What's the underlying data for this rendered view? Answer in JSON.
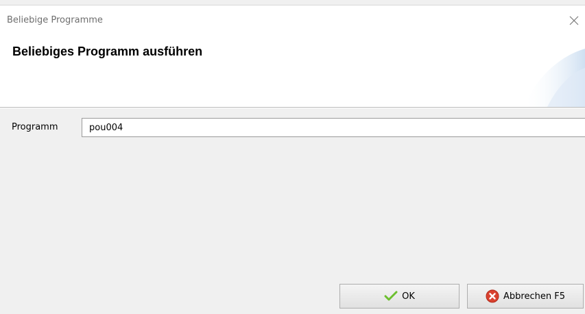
{
  "window": {
    "title": "Beliebige Programme",
    "close_icon": "close-icon"
  },
  "header": {
    "title": "Beliebiges Programm ausführen"
  },
  "form": {
    "program_label": "Programm",
    "program_value": "pou004"
  },
  "buttons": {
    "ok_label": "OK",
    "ok_icon": "checkmark-icon",
    "cancel_label": "Abbrechen F5",
    "cancel_icon": "cancel-icon"
  },
  "colors": {
    "ok_check": "#6cbf2e",
    "cancel_red": "#d9412f"
  }
}
